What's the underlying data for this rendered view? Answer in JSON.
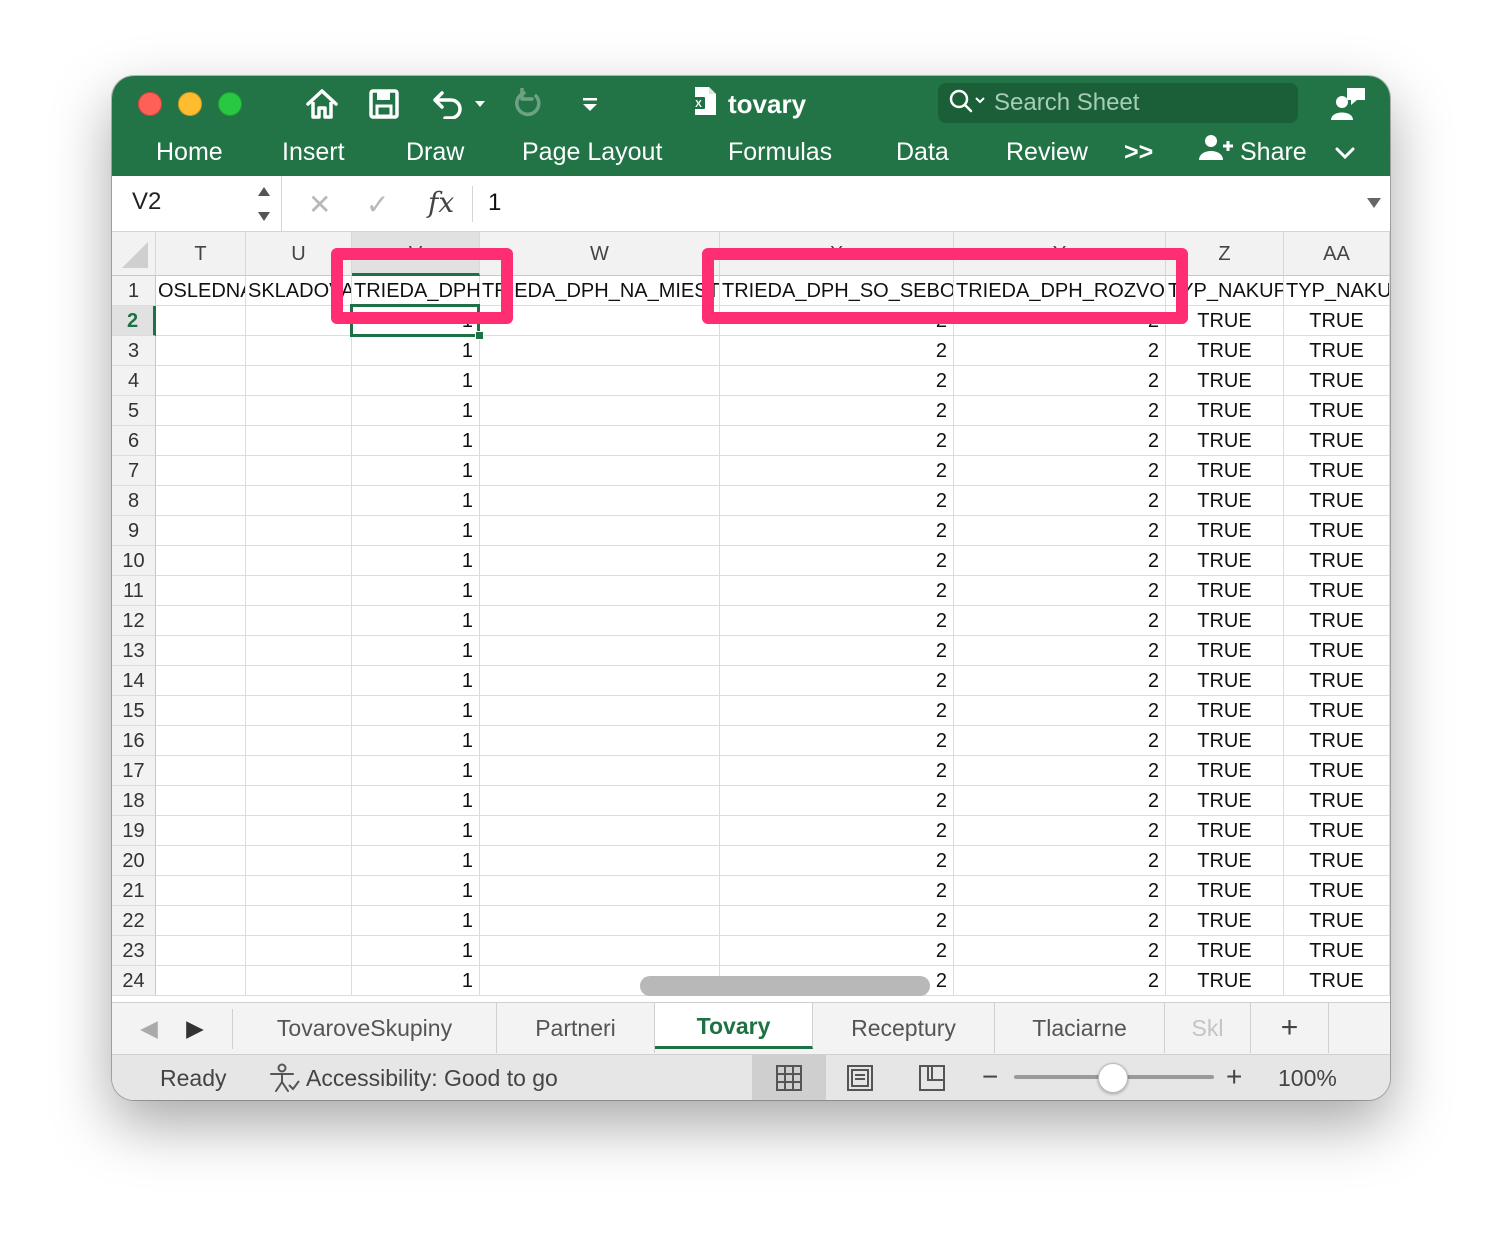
{
  "window": {
    "title": "tovary",
    "search_placeholder": "Search Sheet",
    "share_label": "Share"
  },
  "ribbon": {
    "tabs": [
      "Home",
      "Insert",
      "Draw",
      "Page Layout",
      "Formulas",
      "Data",
      "Review"
    ],
    "more_label": ">>"
  },
  "formula_bar": {
    "name_box": "V2",
    "fx_label": "fx",
    "value": "1"
  },
  "sheet": {
    "column_letters": [
      "T",
      "U",
      "V",
      "W",
      "X",
      "Y",
      "Z",
      "AA"
    ],
    "header_row_number": "1",
    "headers": [
      "OSLEDNA_",
      "SKLADOVA",
      "TRIEDA_DPH",
      "TRIEDA_DPH_NA_MIESTE",
      "TRIEDA_DPH_SO_SEBOU",
      "TRIEDA_DPH_ROZVOZ",
      "TYP_NAKUPU",
      "TYP_NAKUPU"
    ],
    "row_numbers": [
      "2",
      "3",
      "4",
      "5",
      "6",
      "7",
      "8",
      "9",
      "10",
      "11",
      "12",
      "13",
      "14",
      "15",
      "16",
      "17",
      "18",
      "19",
      "20",
      "21",
      "22",
      "23",
      "24"
    ],
    "row_values": {
      "trieda_dph": "1",
      "trieda_dph_so_sebou": "2",
      "trieda_dph_rozvoz": "2",
      "typ_nakupu_z": "TRUE",
      "typ_nakupu_aa": "TRUE"
    },
    "selected_cell": "V2",
    "highlight_color": "#ff2d72",
    "accent_color": "#1e7145"
  },
  "sheet_tabs": {
    "tabs": [
      "TovaroveSkupiny",
      "Partneri",
      "Tovary",
      "Receptury",
      "Tlaciarne",
      "Skl"
    ],
    "active": "Tovary",
    "add_label": "+"
  },
  "status_bar": {
    "ready": "Ready",
    "accessibility": "Accessibility: Good to go",
    "zoom": "100%"
  }
}
